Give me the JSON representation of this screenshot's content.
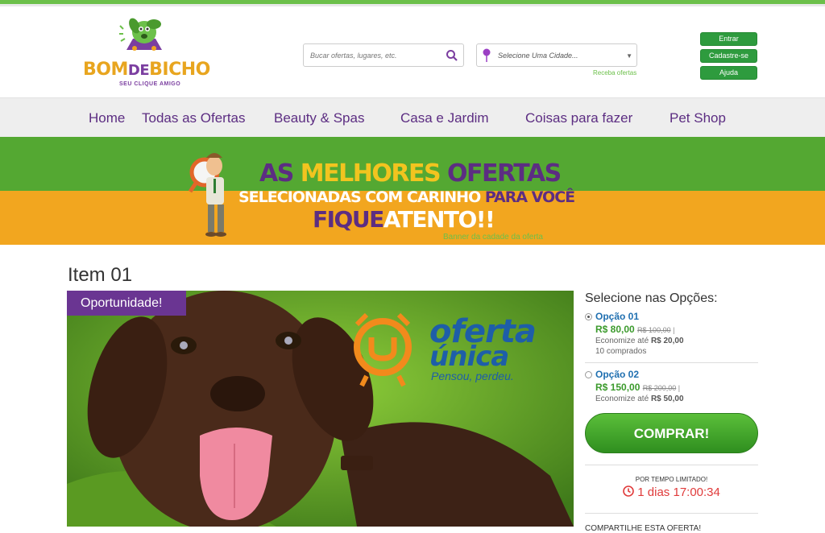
{
  "header": {
    "logo": {
      "text_main": "BOM",
      "text_de": "DE",
      "text_end": "BICHO",
      "tagline": "SEU CLIQUE AMIGO"
    },
    "search": {
      "placeholder": "Bucar ofertas, lugares, etc."
    },
    "city": {
      "label": "Selecione Uma Cidade...",
      "link": "Receba ofertas"
    },
    "buttons": {
      "login": "Entrar",
      "signup": "Cadastre-se",
      "help": "Ajuda"
    }
  },
  "nav": {
    "items": [
      "Home",
      "Todas as Ofertas",
      "Beauty & Spas",
      "Casa e Jardim",
      "Coisas para fazer",
      "Pet Shop"
    ]
  },
  "banner": {
    "line1_a": "AS ",
    "line1_b": "MELHORES ",
    "line1_c": "OFERTAS",
    "line2_a": "SELECIONADAS COM CARINHO ",
    "line2_b": "PARA VOCÊ",
    "line3_a": "FIQUE",
    "line3_b": "ATENTO!!",
    "caption": "Banner da cadade da oferta"
  },
  "deal": {
    "title": "Item 01",
    "badge": "Oportunidade!",
    "image_logo_line1": "oferta",
    "image_logo_line2": "única",
    "image_logo_tagline": "Pensou, perdeu."
  },
  "options": {
    "title": "Selecione nas Opções:",
    "items": [
      {
        "name": "Opção 01",
        "price": "R$ 80,00",
        "old_price": "R$ 100,00",
        "sep": " |",
        "save_label": "Economize até ",
        "save_value": "R$ 20,00",
        "sold": "10 comprados",
        "selected": true
      },
      {
        "name": "Opção 02",
        "price": "R$ 150,00",
        "old_price": "R$ 200,00",
        "sep": " |",
        "save_label": "Economize até ",
        "save_value": "R$ 50,00",
        "sold": "",
        "selected": false
      }
    ],
    "buy_label": "COMPRAR!",
    "limited_label": "POR TEMPO LIMITADO!",
    "timer": "1 dias 17:00:34",
    "share_label": "COMPARTILHE ESTA OFERTA!"
  },
  "colors": {
    "brand_purple": "#5c2d82",
    "brand_green": "#54a832",
    "brand_orange": "#f2a61f",
    "button_green": "#2e9b3e"
  }
}
